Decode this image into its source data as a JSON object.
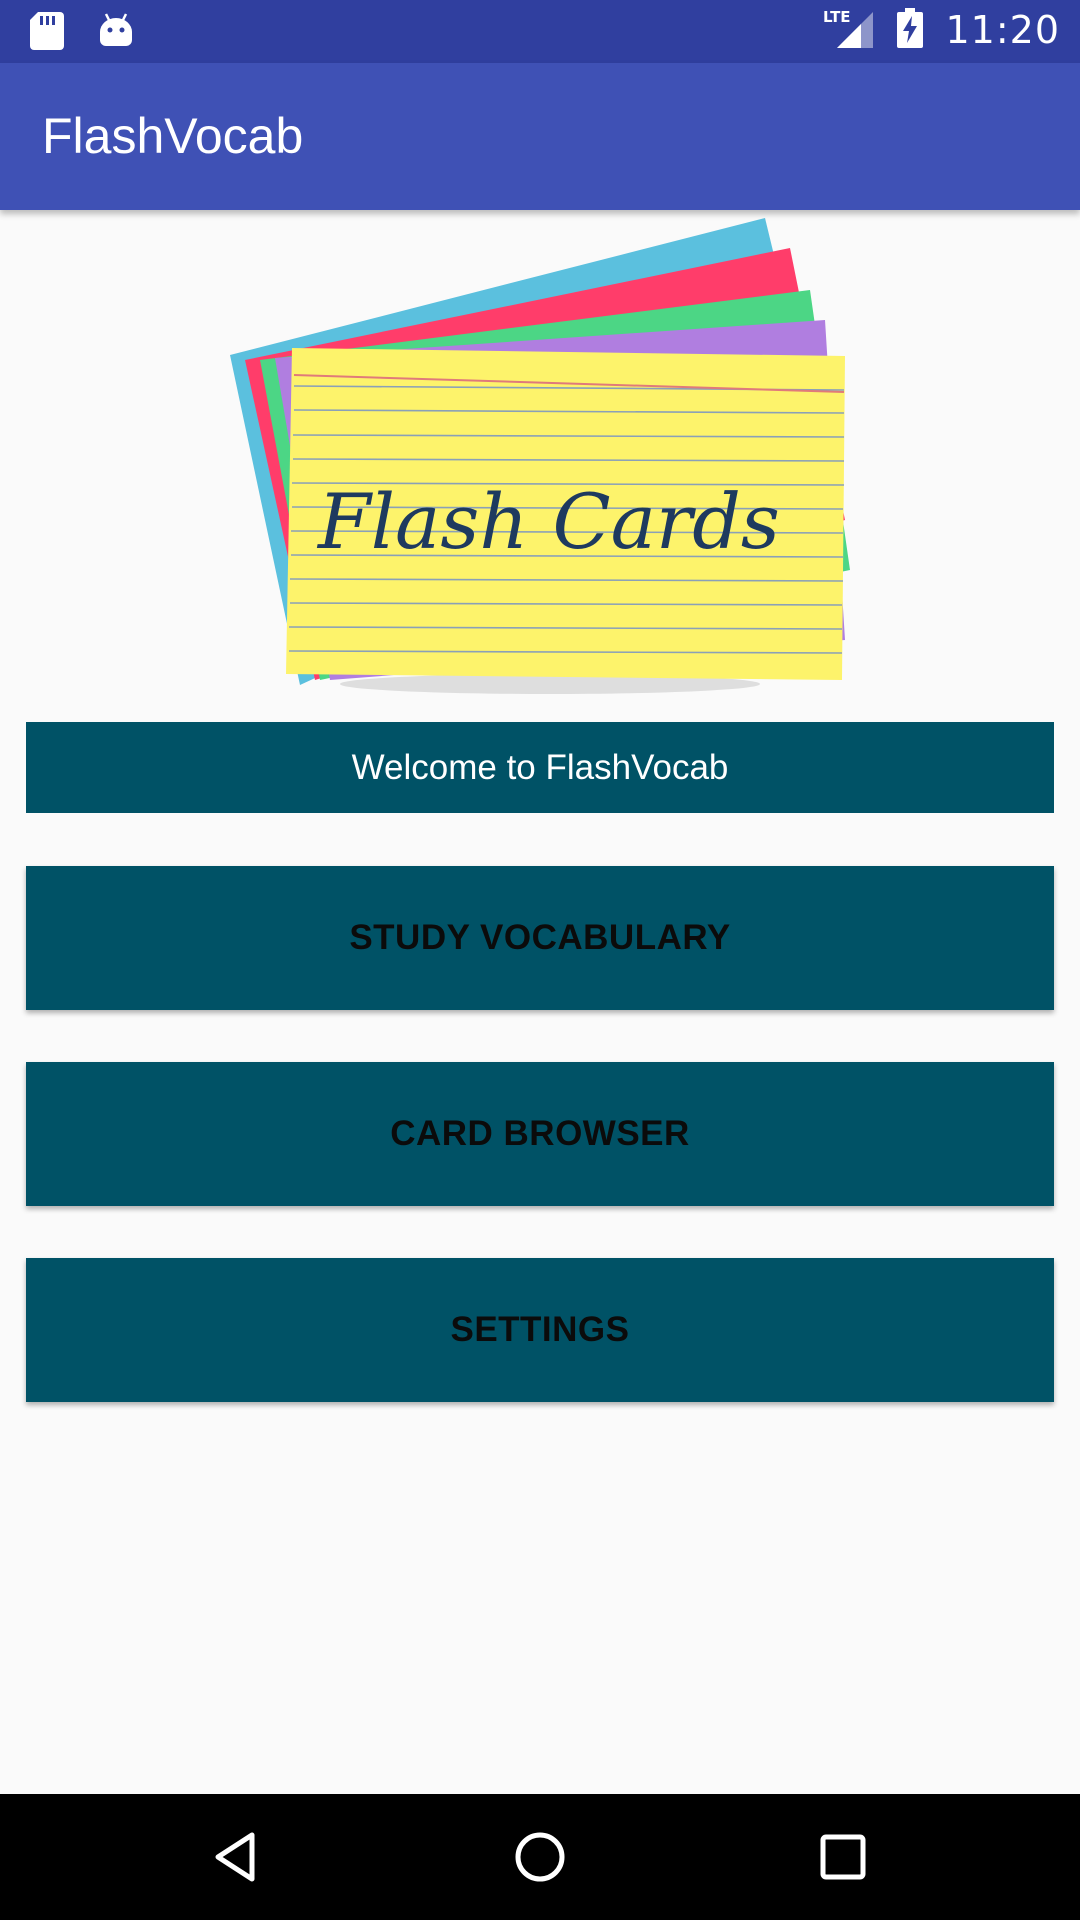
{
  "status_bar": {
    "time": "11:20",
    "network": "LTE",
    "icons": [
      "sd-card-icon",
      "android-icon",
      "signal-icon",
      "battery-charging-icon"
    ]
  },
  "app_bar": {
    "title": "FlashVocab"
  },
  "hero": {
    "image_text": "Flash Cards"
  },
  "welcome": {
    "text": "Welcome to FlashVocab"
  },
  "menu": {
    "study_label": "STUDY VOCABULARY",
    "browser_label": "CARD BROWSER",
    "settings_label": "SETTINGS"
  },
  "nav_bar": {
    "icons": [
      "back-icon",
      "home-icon",
      "recents-icon"
    ]
  },
  "colors": {
    "primary": "#3f51b5",
    "primary_dark": "#303f9f",
    "button": "#005266"
  }
}
